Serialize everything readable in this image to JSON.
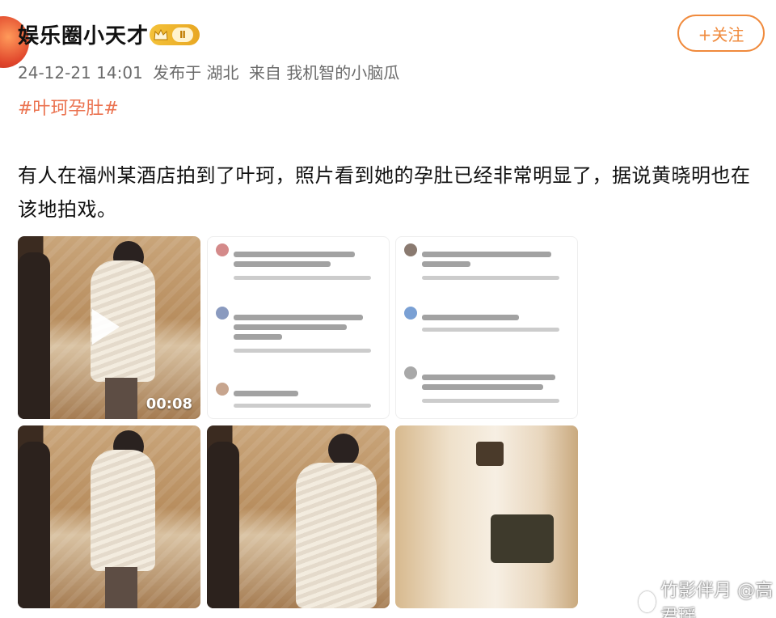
{
  "user": {
    "name": "娱乐圈小天才",
    "level_badge": "Ⅱ"
  },
  "meta": {
    "datetime": "24-12-21 14:01",
    "location": "发布于 湖北",
    "source": "来自 我机智的小脑瓜"
  },
  "follow_label": "+关注",
  "hashtag": "#叶珂孕肚#",
  "post_text": "有人在福州某酒店拍到了叶珂，照片看到她的孕肚已经非常明显了，据说黄晓明也在该地拍戏。",
  "video": {
    "duration": "00:08"
  },
  "watermark": "竹影伴月 @高君瑶",
  "colors": {
    "accent": "#f08a3c",
    "hashtag": "#eb7350"
  }
}
